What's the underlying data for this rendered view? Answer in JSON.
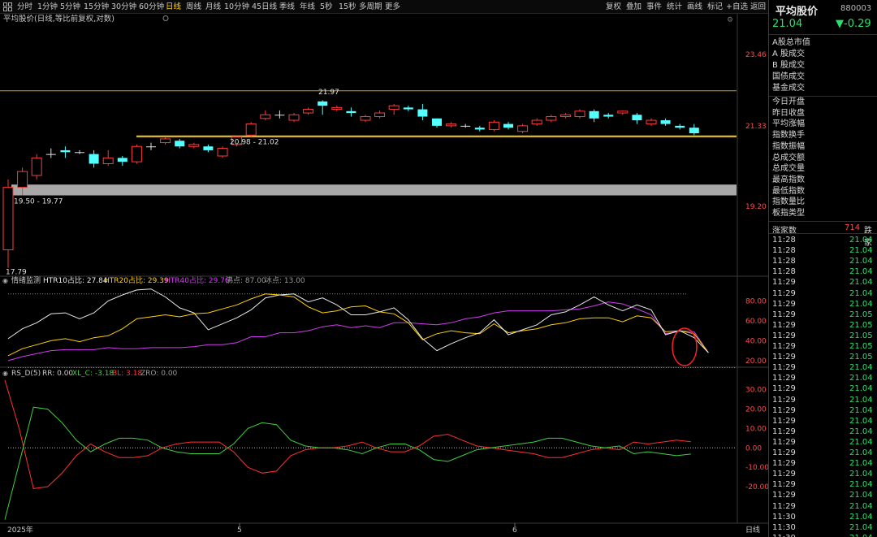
{
  "toolbar": {
    "timeframes": [
      {
        "label": "分时"
      },
      {
        "label": "1分钟"
      },
      {
        "label": "5分钟"
      },
      {
        "label": "15分钟"
      },
      {
        "label": "30分钟"
      },
      {
        "label": "60分钟"
      },
      {
        "label": "日线",
        "active": true
      },
      {
        "label": "周线"
      },
      {
        "label": "月线"
      },
      {
        "label": "10分钟"
      },
      {
        "label": "45日线"
      },
      {
        "label": "季线"
      },
      {
        "label": "年线"
      },
      {
        "label": "5秒"
      },
      {
        "label": "15秒"
      },
      {
        "label": "多周期"
      },
      {
        "label": "更多"
      }
    ],
    "right_tools": [
      {
        "label": "复权"
      },
      {
        "label": "叠加"
      },
      {
        "label": "事件"
      },
      {
        "label": "统计"
      },
      {
        "label": "画线"
      },
      {
        "label": "标记"
      },
      {
        "label": "+自选"
      },
      {
        "label": "返回"
      }
    ]
  },
  "main_chart": {
    "title": "平均股价(日线,等比前复权,对数)",
    "y_axis_labels": [
      "23.46",
      "21.33",
      "19.20"
    ],
    "annotations": {
      "high": "21.97",
      "low": "17.79",
      "range_upper": "20.98 - 21.02",
      "range_lower": "19.50 - 19.77"
    },
    "candles": [
      [
        18.2,
        19.7,
        17.79,
        19.9
      ],
      [
        19.7,
        20.1,
        19.5,
        20.2
      ],
      [
        20.0,
        20.45,
        19.9,
        20.55
      ],
      [
        20.55,
        20.55,
        20.45,
        20.7
      ],
      [
        20.65,
        20.6,
        20.45,
        20.75
      ],
      [
        20.6,
        20.6,
        20.55,
        20.65
      ],
      [
        20.55,
        20.3,
        20.2,
        20.65
      ],
      [
        20.3,
        20.45,
        20.25,
        20.65
      ],
      [
        20.45,
        20.35,
        20.25,
        20.5
      ],
      [
        20.35,
        20.75,
        20.3,
        20.8
      ],
      [
        20.75,
        20.75,
        20.65,
        20.85
      ],
      [
        20.85,
        20.95,
        20.8,
        21.0
      ],
      [
        20.9,
        20.75,
        20.7,
        20.95
      ],
      [
        20.75,
        20.8,
        20.7,
        20.85
      ],
      [
        20.75,
        20.65,
        20.6,
        20.8
      ],
      [
        20.5,
        20.7,
        20.45,
        20.75
      ],
      [
        20.8,
        21.0,
        20.75,
        21.02
      ],
      [
        21.05,
        21.35,
        21.0,
        21.4
      ],
      [
        21.5,
        21.6,
        21.45,
        21.72
      ],
      [
        21.6,
        21.6,
        21.5,
        21.72
      ],
      [
        21.45,
        21.6,
        21.4,
        21.65
      ],
      [
        21.65,
        21.75,
        21.6,
        21.8
      ],
      [
        21.97,
        21.85,
        21.6,
        22.0
      ],
      [
        21.75,
        21.8,
        21.7,
        21.85
      ],
      [
        21.7,
        21.65,
        21.55,
        21.8
      ],
      [
        21.45,
        21.55,
        21.4,
        21.6
      ],
      [
        21.55,
        21.65,
        21.5,
        21.72
      ],
      [
        21.75,
        21.85,
        21.6,
        21.9
      ],
      [
        21.8,
        21.75,
        21.7,
        21.85
      ],
      [
        21.75,
        21.55,
        21.45,
        21.9
      ],
      [
        21.5,
        21.3,
        21.25,
        21.5
      ],
      [
        21.3,
        21.35,
        21.25,
        21.4
      ],
      [
        21.3,
        21.3,
        21.25,
        21.35
      ],
      [
        21.25,
        21.2,
        21.15,
        21.3
      ],
      [
        21.2,
        21.4,
        21.15,
        21.45
      ],
      [
        21.35,
        21.25,
        21.2,
        21.4
      ],
      [
        21.15,
        21.3,
        21.1,
        21.35
      ],
      [
        21.35,
        21.45,
        21.3,
        21.5
      ],
      [
        21.45,
        21.55,
        21.4,
        21.6
      ],
      [
        21.55,
        21.6,
        21.5,
        21.65
      ],
      [
        21.55,
        21.7,
        21.5,
        21.75
      ],
      [
        21.7,
        21.5,
        21.4,
        21.75
      ],
      [
        21.6,
        21.55,
        21.5,
        21.65
      ],
      [
        21.65,
        21.7,
        21.6,
        21.72
      ],
      [
        21.6,
        21.45,
        21.35,
        21.65
      ],
      [
        21.35,
        21.45,
        21.3,
        21.5
      ],
      [
        21.45,
        21.35,
        21.3,
        21.5
      ],
      [
        21.3,
        21.25,
        21.2,
        21.35
      ],
      [
        21.25,
        21.1,
        21.05,
        21.35
      ]
    ],
    "y_range": [
      17.6,
      24.2
    ]
  },
  "sentiment": {
    "title": "情绪监测",
    "htr10_label": "HTR10占比: 27.84",
    "htr20_label": "HTR20占比: 29.39",
    "htr40_label": "HTR40占比: 29.76",
    "boil_label": "沸点: 87.00",
    "freeze_label": "冰点: 13.00",
    "y_axis_labels": [
      "80.00",
      "60.00",
      "40.00",
      "20.00"
    ],
    "colors": {
      "htr10": "#e8e8e8",
      "htr20": "#ffd100",
      "htr40": "#d23cf0"
    },
    "htr10": [
      42,
      52,
      58,
      67,
      68,
      62,
      68,
      80,
      86,
      91,
      92,
      84,
      73,
      68,
      51,
      57,
      63,
      71,
      83,
      86,
      87,
      79,
      83,
      76,
      66,
      66,
      69,
      73,
      61,
      42,
      30,
      37,
      43,
      48,
      61,
      46,
      51,
      56,
      66,
      69,
      76,
      84,
      76,
      70,
      76,
      71,
      46,
      50,
      43,
      28
    ],
    "htr20": [
      25,
      32,
      36,
      40,
      42,
      39,
      43,
      45,
      52,
      62,
      64,
      66,
      64,
      67,
      68,
      72,
      76,
      82,
      87,
      86,
      84,
      74,
      68,
      70,
      74,
      75,
      69,
      67,
      58,
      41,
      47,
      50,
      48,
      47,
      57,
      48,
      50,
      52,
      56,
      58,
      62,
      63,
      63,
      59,
      65,
      63,
      49,
      50,
      47,
      28
    ],
    "htr40": [
      20,
      24,
      27,
      30,
      31,
      31,
      31,
      33,
      32,
      32,
      33,
      33,
      33,
      34,
      36,
      36,
      38,
      44,
      44,
      48,
      48,
      50,
      54,
      56,
      53,
      55,
      53,
      58,
      58,
      57,
      56,
      58,
      62,
      64,
      68,
      70,
      70,
      70,
      70,
      71,
      72,
      75,
      79,
      77,
      72,
      66,
      47,
      50,
      49,
      28
    ],
    "y_range": [
      15,
      95
    ],
    "ref_line": 87
  },
  "rsd": {
    "title": "RS_D(5)",
    "rr_label": "RR: 0.00",
    "xlc_label": "XL_C: -3.18",
    "bl_label": "BL: 3.18",
    "zro_label": "ZRO: 0.00",
    "y_axis_labels": [
      "30.00",
      "20.00",
      "10.00",
      "0.00",
      "-10.00",
      "-20.00"
    ],
    "colors": {
      "green": "#3fd13f",
      "red": "#ff3030"
    },
    "green": [
      -37,
      -8,
      21,
      20,
      13,
      4,
      -2,
      2,
      5,
      5,
      4,
      0,
      -2,
      -3,
      -3,
      -3,
      2,
      10,
      13,
      12,
      4,
      1,
      0,
      0,
      -1,
      -3,
      0,
      2,
      2,
      -1,
      -6,
      -7,
      -4,
      -1,
      0,
      1,
      2,
      3,
      5,
      5,
      3,
      1,
      0,
      1,
      -3,
      -2,
      -3,
      -4,
      -3.18
    ],
    "red": [
      35,
      10,
      -21,
      -20,
      -13,
      -4,
      2,
      -2,
      -5,
      -5,
      -4,
      0,
      2,
      3,
      3,
      3,
      -2,
      -10,
      -13,
      -12,
      -4,
      -1,
      0,
      0,
      1,
      3,
      0,
      -2,
      -2,
      1,
      6,
      7,
      4,
      1,
      0,
      -1,
      -2,
      -3,
      -5,
      -5,
      -3,
      -1,
      0,
      -1,
      3,
      2,
      3,
      4,
      3.18
    ],
    "y_range": [
      -38,
      37
    ]
  },
  "x_axis": {
    "labels": [
      "2025年",
      "5",
      "6"
    ],
    "period_label": "日线"
  },
  "right_panel": {
    "name": "平均股价",
    "code": "880003",
    "price": "21.04",
    "change": "▼-0.29",
    "info_items": [
      "A股总市值",
      "A 股成交",
      "B 股成交",
      "国债成交",
      "基金成交"
    ],
    "stats_items": [
      "今日开盘",
      "昨日收盘",
      "平均涨幅",
      "指数换手",
      "指数振幅",
      "总成交额",
      "总成交量",
      "最高指数",
      "最低指数",
      "指数量比",
      "板指类型"
    ],
    "up_label": "涨家数",
    "up_count": "714",
    "down_label": "跌家",
    "ticks": [
      {
        "t": "11:28",
        "p": "21.04"
      },
      {
        "t": "11:28",
        "p": "21.04"
      },
      {
        "t": "11:28",
        "p": "21.04"
      },
      {
        "t": "11:28",
        "p": "21.04"
      },
      {
        "t": "11:29",
        "p": "21.04"
      },
      {
        "t": "11:29",
        "p": "21.04"
      },
      {
        "t": "11:29",
        "p": "21.04"
      },
      {
        "t": "11:29",
        "p": "21.05"
      },
      {
        "t": "11:29",
        "p": "21.05"
      },
      {
        "t": "11:29",
        "p": "21.05"
      },
      {
        "t": "11:29",
        "p": "21.05"
      },
      {
        "t": "11:29",
        "p": "21.05"
      },
      {
        "t": "11:29",
        "p": "21.04"
      },
      {
        "t": "11:29",
        "p": "21.04"
      },
      {
        "t": "11:29",
        "p": "21.04"
      },
      {
        "t": "11:29",
        "p": "21.04"
      },
      {
        "t": "11:29",
        "p": "21.04"
      },
      {
        "t": "11:29",
        "p": "21.04"
      },
      {
        "t": "11:29",
        "p": "21.04"
      },
      {
        "t": "11:29",
        "p": "21.04"
      },
      {
        "t": "11:29",
        "p": "21.04"
      },
      {
        "t": "11:29",
        "p": "21.04"
      },
      {
        "t": "11:29",
        "p": "21.04"
      },
      {
        "t": "11:29",
        "p": "21.04"
      },
      {
        "t": "11:29",
        "p": "21.04"
      },
      {
        "t": "11:29",
        "p": "21.04"
      },
      {
        "t": "11:30",
        "p": "21.04"
      },
      {
        "t": "11:30",
        "p": "21.04"
      },
      {
        "t": "11:30",
        "p": "21.04"
      }
    ]
  },
  "chart_data": [
    {
      "type": "candlestick",
      "title": "平均股价(日线,等比前复权,对数)",
      "ylim": [
        17.6,
        24.2
      ]
    },
    {
      "type": "line",
      "title": "情绪监测",
      "series": [
        {
          "name": "HTR10占比"
        },
        {
          "name": "HTR20占比"
        },
        {
          "name": "HTR40占比"
        }
      ],
      "ylim": [
        15,
        95
      ]
    },
    {
      "type": "line",
      "title": "RS_D(5)",
      "series": [
        {
          "name": "XL_C"
        },
        {
          "name": "BL"
        }
      ],
      "ylim": [
        -38,
        37
      ]
    }
  ]
}
